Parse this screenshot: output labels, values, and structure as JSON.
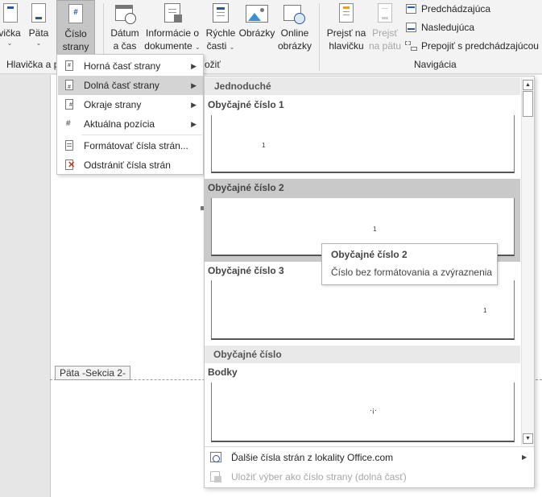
{
  "ribbon": {
    "buttons": {
      "header": "vička",
      "footer": "Päta",
      "page_number_line1": "Číslo",
      "page_number_line2": "strany",
      "date_line1": "Dátum",
      "date_line2": "a čas",
      "docinfo_line1": "Informácie o",
      "docinfo_line2": "dokumente",
      "quick_line1": "Rýchle",
      "quick_line2": "časti",
      "pictures": "Obrázky",
      "online_line1": "Online",
      "online_line2": "obrázky",
      "goto_header_line1": "Prejsť na",
      "goto_header_line2": "hlavičku",
      "goto_footer_line1": "Prejsť",
      "goto_footer_line2": "na pätu"
    },
    "nav": {
      "previous": "Predchádzajúca",
      "next": "Nasledujúca",
      "link_previous": "Prepojiť s predchádzajúcou"
    },
    "groups": {
      "header_footer": "Hlavička a p",
      "insert": "ožiť",
      "navigation": "Navigácia"
    }
  },
  "menu": {
    "items": [
      {
        "label": "Horná časť strany",
        "submenu": true
      },
      {
        "label": "Dolná časť strany",
        "submenu": true,
        "selected": true
      },
      {
        "label": "Okraje strany",
        "submenu": true
      },
      {
        "label": "Aktuálna pozícia",
        "submenu": true
      },
      {
        "label": "Formátovať čísla strán...",
        "submenu": false
      },
      {
        "label": "Odstrániť čísla strán",
        "submenu": false
      }
    ]
  },
  "gallery": {
    "section_simple": "Jednoduché",
    "items": [
      {
        "title": "Obyčajné číslo 1",
        "sample": "1"
      },
      {
        "title": "Obyčajné číslo 2",
        "sample": "1"
      },
      {
        "title": "Obyčajné číslo 3",
        "sample": "1"
      }
    ],
    "section_plain": "Obyčajné číslo",
    "dots_title": "Bodky",
    "dots_sample": "·¡·",
    "footer": {
      "more": "Ďalšie čísla strán z lokality Office.com",
      "save": "Uložiť výber ako číslo strany (dolná časť)"
    }
  },
  "tooltip": {
    "title": "Obyčajné číslo 2",
    "description": "Číslo bez formátovania a zvýraznenia"
  },
  "document": {
    "footer_tag": "Päta -Sekcia 2-"
  },
  "colors": {
    "ribbon_bg": "#f3f3f3",
    "selected_button": "#c5c5c5",
    "menu_selected": "#d4d4d4",
    "gallery_highlight": "#c9c9c9",
    "icon_blue": "#2b579a",
    "icon_red": "#c43e1c"
  }
}
